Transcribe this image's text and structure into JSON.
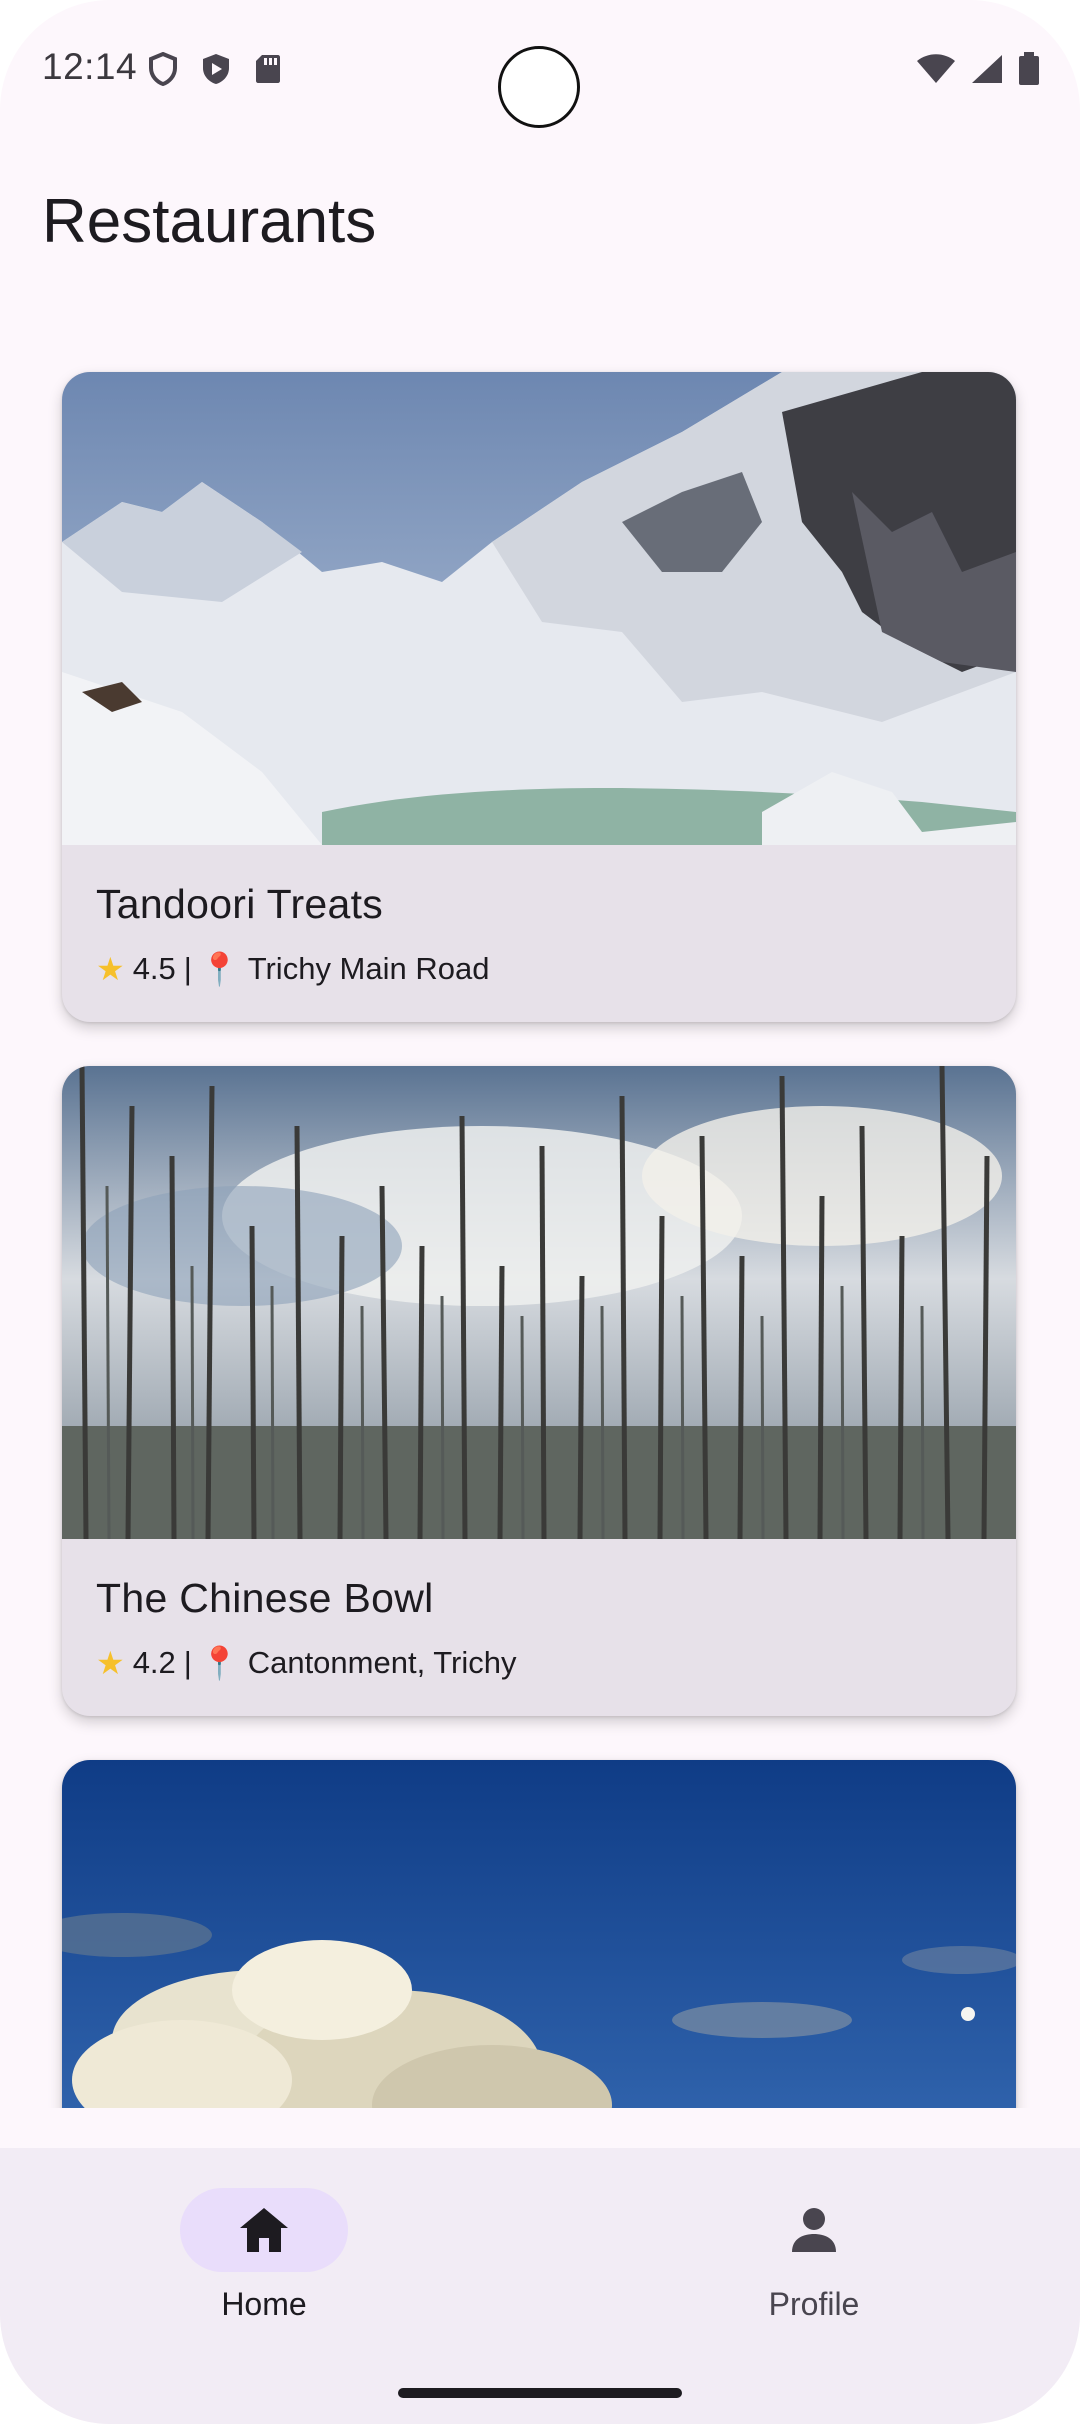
{
  "status_bar": {
    "time": "12:14",
    "icons_left": [
      "shield-icon",
      "play-protect-icon",
      "sd-card-icon"
    ],
    "icons_right": [
      "wifi-icon",
      "signal-icon",
      "battery-icon"
    ]
  },
  "app_bar": {
    "title": "Restaurants"
  },
  "restaurants": [
    {
      "name": "Tandoori Treats",
      "rating": "4.5",
      "separator": "|",
      "location": "Trichy Main Road",
      "image": "snowy-mountain-lake"
    },
    {
      "name": "The Chinese Bowl",
      "rating": "4.2",
      "separator": "|",
      "location": "Cantonment, Trichy",
      "image": "bare-forest-clouds"
    },
    {
      "image": "blue-sky-cloud"
    }
  ],
  "bottom_nav": {
    "items": [
      {
        "label": "Home",
        "icon": "home-icon",
        "selected": true
      },
      {
        "label": "Profile",
        "icon": "person-icon",
        "selected": false
      }
    ]
  },
  "colors": {
    "background": "#fdf7fc",
    "card": "#e7e1e9",
    "nav_background": "#f2ecf5",
    "nav_indicator": "#e9ddfb",
    "text": "#1d1b20"
  }
}
